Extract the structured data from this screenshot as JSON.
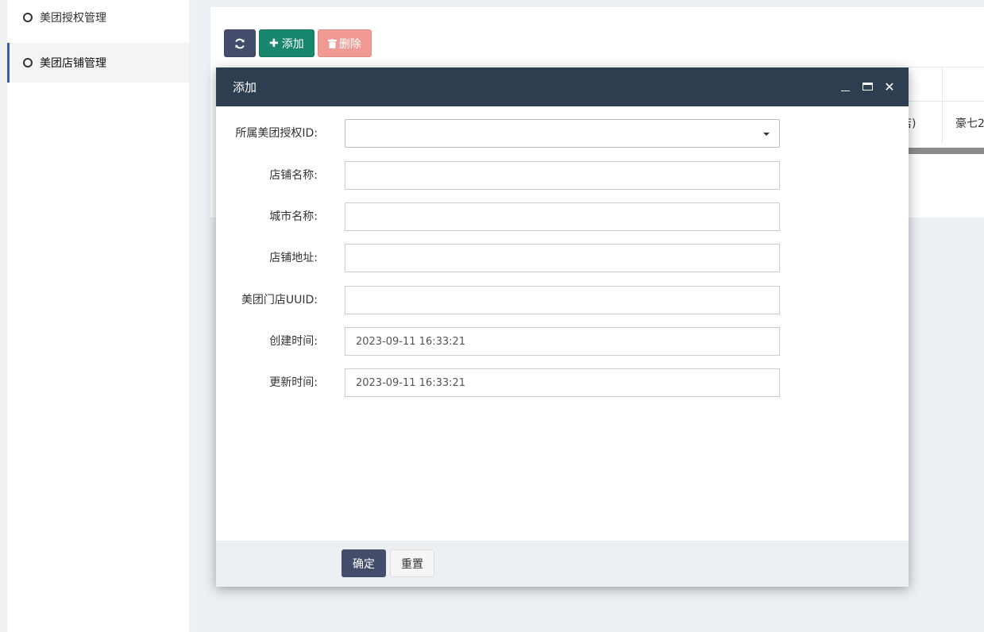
{
  "sidebar": {
    "items": [
      {
        "label": "美团授权管理",
        "active": false
      },
      {
        "label": "美团店铺管理",
        "active": true
      }
    ]
  },
  "toolbar": {
    "refresh_icon": "refresh-icon",
    "add_label": "添加",
    "delete_label": "删除"
  },
  "background_table": {
    "row1_cell1": "馆店)",
    "row1_cell2": "豪七2"
  },
  "modal": {
    "title": "添加",
    "fields": [
      {
        "label": "所属美团授权ID:",
        "type": "select",
        "value": ""
      },
      {
        "label": "店铺名称:",
        "type": "text",
        "value": ""
      },
      {
        "label": "城市名称:",
        "type": "text",
        "value": ""
      },
      {
        "label": "店铺地址:",
        "type": "text",
        "value": ""
      },
      {
        "label": "美团门店UUID:",
        "type": "text",
        "value": ""
      },
      {
        "label": "创建时间:",
        "type": "text",
        "value": "2023-09-11 16:33:21"
      },
      {
        "label": "更新时间:",
        "type": "text",
        "value": "2023-09-11 16:33:21"
      }
    ],
    "confirm_label": "确定",
    "reset_label": "重置"
  },
  "colors": {
    "modal_header": "#2e3e50",
    "add_button": "#18866c",
    "delete_button": "#f19a93",
    "primary_button": "#444c6b",
    "sidebar_active_border": "#3c5da8"
  }
}
